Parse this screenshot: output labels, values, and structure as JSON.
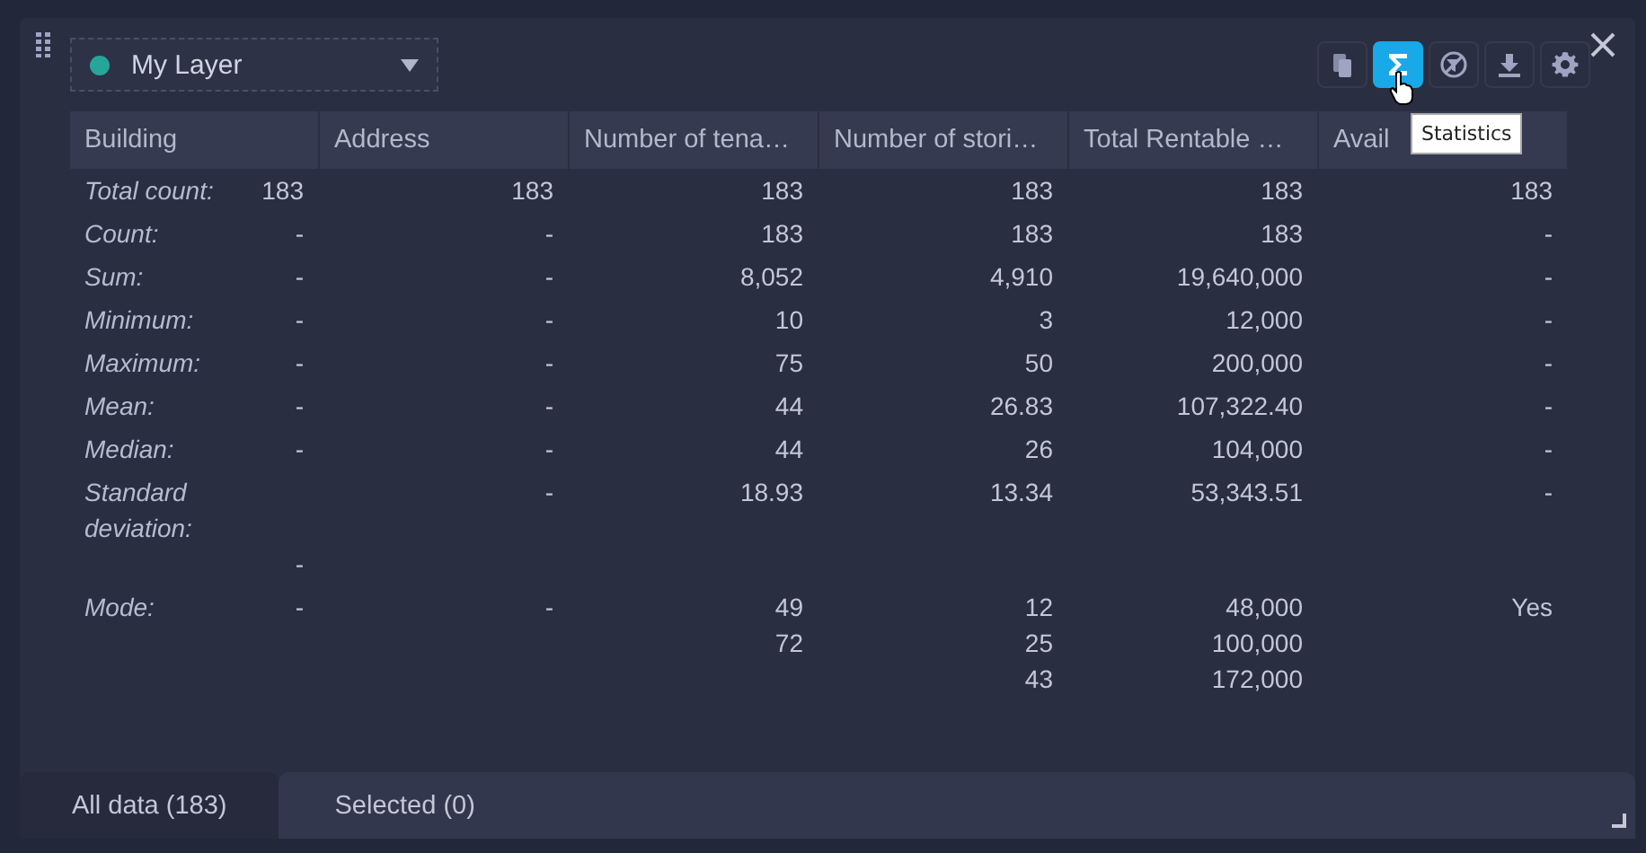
{
  "layer_select": {
    "value": "My Layer",
    "color": "#26a69a"
  },
  "toolbar": [
    {
      "kind": "copy",
      "selected": false
    },
    {
      "kind": "statistics",
      "selected": true
    },
    {
      "kind": "filter-off",
      "selected": false
    },
    {
      "kind": "download",
      "selected": false
    },
    {
      "kind": "settings",
      "selected": false
    }
  ],
  "tooltip": "Statistics",
  "table": {
    "columns": [
      "Building",
      "Address",
      "Number of tena…",
      "Number of stori…",
      "Total Rentable …",
      "Avail"
    ],
    "rows": [
      {
        "label": "Total count:",
        "cells": [
          [
            "183"
          ],
          [
            "183"
          ],
          [
            "183"
          ],
          [
            "183"
          ],
          [
            "183"
          ],
          [
            "183"
          ]
        ]
      },
      {
        "label": "Count:",
        "cells": [
          [
            "-"
          ],
          [
            "-"
          ],
          [
            "183"
          ],
          [
            "183"
          ],
          [
            "183"
          ],
          [
            "-"
          ]
        ]
      },
      {
        "label": "Sum:",
        "cells": [
          [
            "-"
          ],
          [
            "-"
          ],
          [
            "8,052"
          ],
          [
            "4,910"
          ],
          [
            "19,640,000"
          ],
          [
            "-"
          ]
        ]
      },
      {
        "label": "Minimum:",
        "cells": [
          [
            "-"
          ],
          [
            "-"
          ],
          [
            "10"
          ],
          [
            "3"
          ],
          [
            "12,000"
          ],
          [
            "-"
          ]
        ]
      },
      {
        "label": "Maximum:",
        "cells": [
          [
            "-"
          ],
          [
            "-"
          ],
          [
            "75"
          ],
          [
            "50"
          ],
          [
            "200,000"
          ],
          [
            "-"
          ]
        ]
      },
      {
        "label": "Mean:",
        "cells": [
          [
            "-"
          ],
          [
            "-"
          ],
          [
            "44"
          ],
          [
            "26.83"
          ],
          [
            "107,322.40"
          ],
          [
            "-"
          ]
        ]
      },
      {
        "label": "Median:",
        "cells": [
          [
            "-"
          ],
          [
            "-"
          ],
          [
            "44"
          ],
          [
            "26"
          ],
          [
            "104,000"
          ],
          [
            "-"
          ]
        ]
      },
      {
        "label": "Standard deviation:",
        "cells": [
          [
            "-"
          ],
          [
            "-"
          ],
          [
            "18.93"
          ],
          [
            "13.34"
          ],
          [
            "53,343.51"
          ],
          [
            "-"
          ]
        ]
      },
      {
        "label": "Mode:",
        "cells": [
          [
            "-"
          ],
          [
            "-"
          ],
          [
            "49",
            "72"
          ],
          [
            "12",
            "25",
            "43"
          ],
          [
            "48,000",
            "100,000",
            "172,000"
          ],
          [
            "Yes"
          ]
        ]
      }
    ]
  },
  "tabs": [
    {
      "label": "All data (183)",
      "selected": true
    },
    {
      "label": "Selected (0)",
      "selected": false
    }
  ]
}
